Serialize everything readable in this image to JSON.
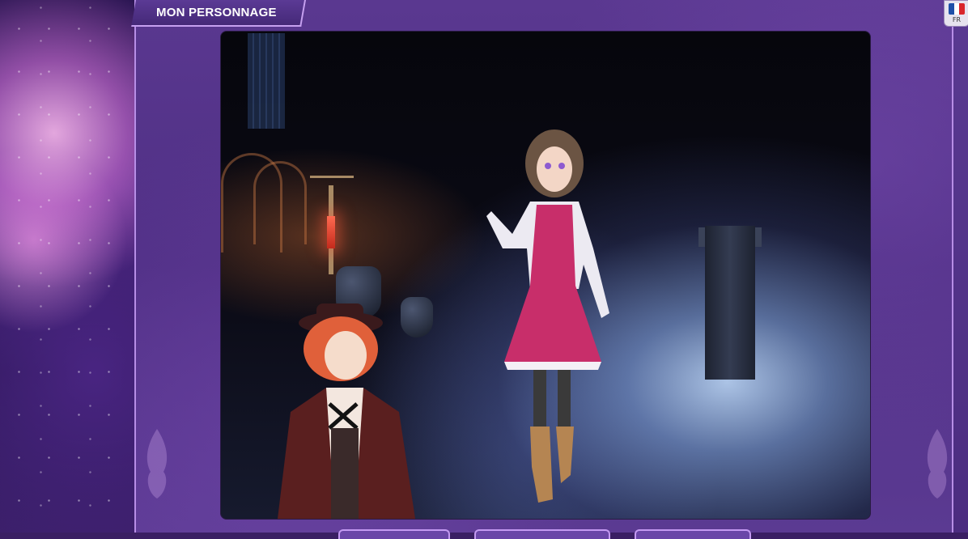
{
  "header": {
    "title": "MON PERSONNAGE"
  },
  "language": {
    "code": "FR",
    "flag_colors": [
      "#1f4fa8",
      "#ffffff",
      "#d9252b"
    ]
  },
  "scene": {
    "description_icon": "gothic-cathedral-background"
  },
  "colors": {
    "accent": "#c6a0f0",
    "panel": "#523288"
  }
}
